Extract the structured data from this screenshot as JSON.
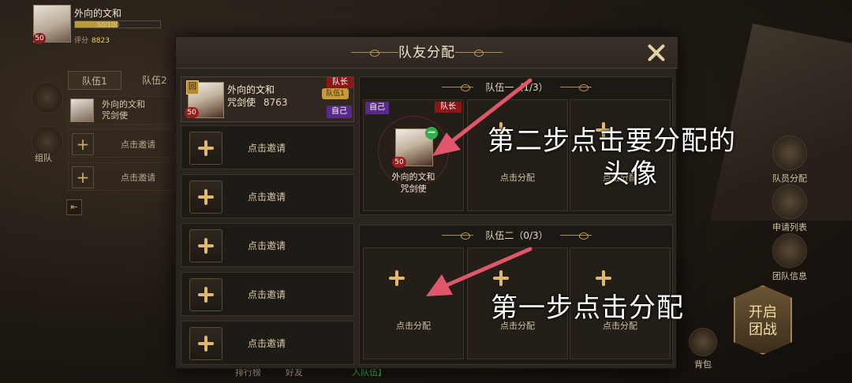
{
  "hud": {
    "player_name": "外向的文和",
    "player_level": "50",
    "bar_text": "50/100",
    "score_label": "评分",
    "score_value": "8823",
    "tabs": [
      "队伍1",
      "队伍2"
    ],
    "member_name_line1": "外向的文和",
    "member_name_line2": "咒剑使",
    "invite_label": "点击邀请",
    "side_label_team": "组队",
    "right_buttons": [
      "队员分配",
      "申请列表",
      "团队信息"
    ],
    "start_button": "开启\n团战",
    "bag_label": "背包",
    "bottom_items": [
      "排行榜",
      "好友",
      "入队伍】"
    ]
  },
  "dialog": {
    "title": "队友分配",
    "member": {
      "rank": "回",
      "level": "50",
      "name": "外向的文和",
      "class": "咒剑使",
      "power": "8763",
      "leader_tag": "队长",
      "team_tag": "队伍1",
      "self_tag": "自己"
    },
    "invite_label": "点击邀请",
    "invite_slots": 5,
    "team1": {
      "title": "队伍一（1/3）",
      "filled": {
        "self_tag": "自己",
        "leader_tag": "队长",
        "level": "50",
        "name": "外向的文和",
        "class": "咒剑使"
      },
      "assign_label": "点击分配"
    },
    "team2": {
      "title": "队伍二（0/3）",
      "assign_label": "点击分配"
    }
  },
  "annotations": {
    "step2_line1": "第二步点击要分配的",
    "step2_line2": "头像",
    "step1": "第一步点击分配",
    "arrow_color": "#e0566a"
  }
}
